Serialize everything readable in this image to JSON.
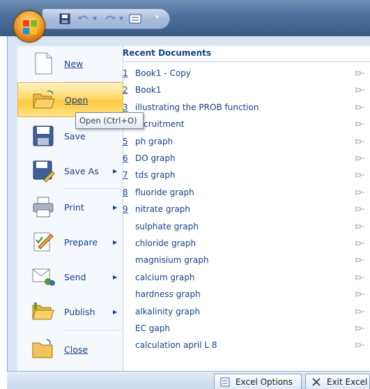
{
  "menu": {
    "commands": [
      {
        "label": "New",
        "has_arrow": false
      },
      {
        "label": "Open",
        "has_arrow": false
      },
      {
        "label": "Save",
        "has_arrow": false
      },
      {
        "label": "Save As",
        "has_arrow": true
      },
      {
        "label": "Print",
        "has_arrow": true
      },
      {
        "label": "Prepare",
        "has_arrow": true
      },
      {
        "label": "Send",
        "has_arrow": true
      },
      {
        "label": "Publish",
        "has_arrow": true
      },
      {
        "label": "Close",
        "has_arrow": false
      }
    ],
    "arrow_glyph": "▶",
    "tooltip": "Open (Ctrl+O)"
  },
  "recent": {
    "title": "Recent Documents",
    "items": [
      {
        "num": "1",
        "name": "Book1 - Copy"
      },
      {
        "num": "2",
        "name": "Book1"
      },
      {
        "num": "3",
        "name": "illustrating the PROB function"
      },
      {
        "num": "4",
        "name": "recruitment"
      },
      {
        "num": "5",
        "name": "ph graph"
      },
      {
        "num": "6",
        "name": "DO graph"
      },
      {
        "num": "7",
        "name": "tds graph"
      },
      {
        "num": "8",
        "name": "fluoride graph"
      },
      {
        "num": "9",
        "name": "nitrate graph"
      },
      {
        "num": "",
        "name": "sulphate graph"
      },
      {
        "num": "",
        "name": "chloride graph"
      },
      {
        "num": "",
        "name": "magnisium graph"
      },
      {
        "num": "",
        "name": "calcium graph"
      },
      {
        "num": "",
        "name": "hardness graph"
      },
      {
        "num": "",
        "name": "alkalinity graph"
      },
      {
        "num": "",
        "name": "EC gaph"
      },
      {
        "num": "",
        "name": "calculation april L 8"
      }
    ]
  },
  "bottom": {
    "options_label": "Excel Options",
    "exit_label": "Exit Excel"
  },
  "colors": {
    "accent": "#15428b",
    "highlight": "#ffd86a",
    "frame": "#dbe6f4"
  }
}
